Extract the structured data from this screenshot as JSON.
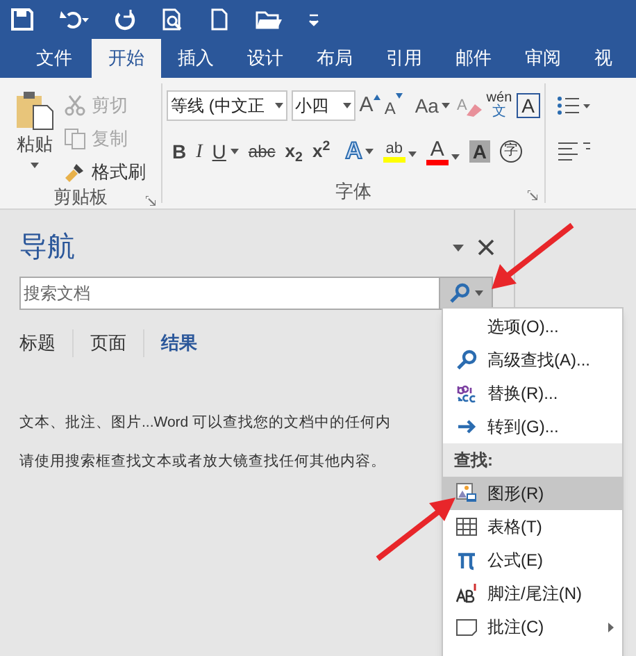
{
  "tabs": [
    {
      "label": "文件",
      "selected": false
    },
    {
      "label": "开始",
      "selected": true
    },
    {
      "label": "插入",
      "selected": false
    },
    {
      "label": "设计",
      "selected": false
    },
    {
      "label": "布局",
      "selected": false
    },
    {
      "label": "引用",
      "selected": false
    },
    {
      "label": "邮件",
      "selected": false
    },
    {
      "label": "审阅",
      "selected": false
    },
    {
      "label": "视",
      "selected": false
    }
  ],
  "clipboard": {
    "paste": "粘贴",
    "items": [
      {
        "label": "剪切",
        "disabled": true
      },
      {
        "label": "复制",
        "disabled": true
      },
      {
        "label": "格式刷",
        "disabled": false
      }
    ],
    "group_label": "剪贴板"
  },
  "font": {
    "name": "等线 (中文正",
    "size": "小四",
    "grow": "A",
    "shrink": "A",
    "case_button": "Aa",
    "clear_format": "A",
    "phonetic": "wén",
    "phonetic_char": "文",
    "bordered_char": "A",
    "bold": "B",
    "italic": "I",
    "underline": "U",
    "strike": "abc",
    "subscript": "x$_{2}$",
    "superscript": "x$^{2}$",
    "text_effect": "A",
    "highlight_label": "ab",
    "font_color": "A",
    "shading": "A",
    "enclosed_char": "字",
    "group_label": "字体"
  },
  "navigation": {
    "title": "导航",
    "search": {
      "placeholder": "搜索文档"
    },
    "tabs": [
      {
        "label": "标题",
        "selected": false
      },
      {
        "label": "页面",
        "selected": false
      },
      {
        "label": "结果",
        "selected": true
      }
    ],
    "messages": [
      "文本、批注、图片...Word 可以查找您的文档中的任何内",
      "请使用搜索框查找文本或者放大镜查找任何其他内容。"
    ]
  },
  "menu": [
    {
      "kind": "item",
      "label": "选项(O)...",
      "selected": false
    },
    {
      "kind": "item",
      "label": "高级查找(A)...",
      "selected": false
    },
    {
      "kind": "item",
      "label": "替换(R)...",
      "selected": false
    },
    {
      "kind": "item",
      "label": "转到(G)...",
      "selected": false
    },
    {
      "kind": "header",
      "label": "查找:"
    },
    {
      "kind": "item",
      "label": "图形(R)",
      "selected": true
    },
    {
      "kind": "item",
      "label": "表格(T)",
      "selected": false
    },
    {
      "kind": "item",
      "label": "公式(E)",
      "selected": false
    },
    {
      "kind": "item",
      "label": "脚注/尾注(N)",
      "selected": false
    },
    {
      "kind": "submenu",
      "label": "批注(C)",
      "selected": false
    }
  ]
}
